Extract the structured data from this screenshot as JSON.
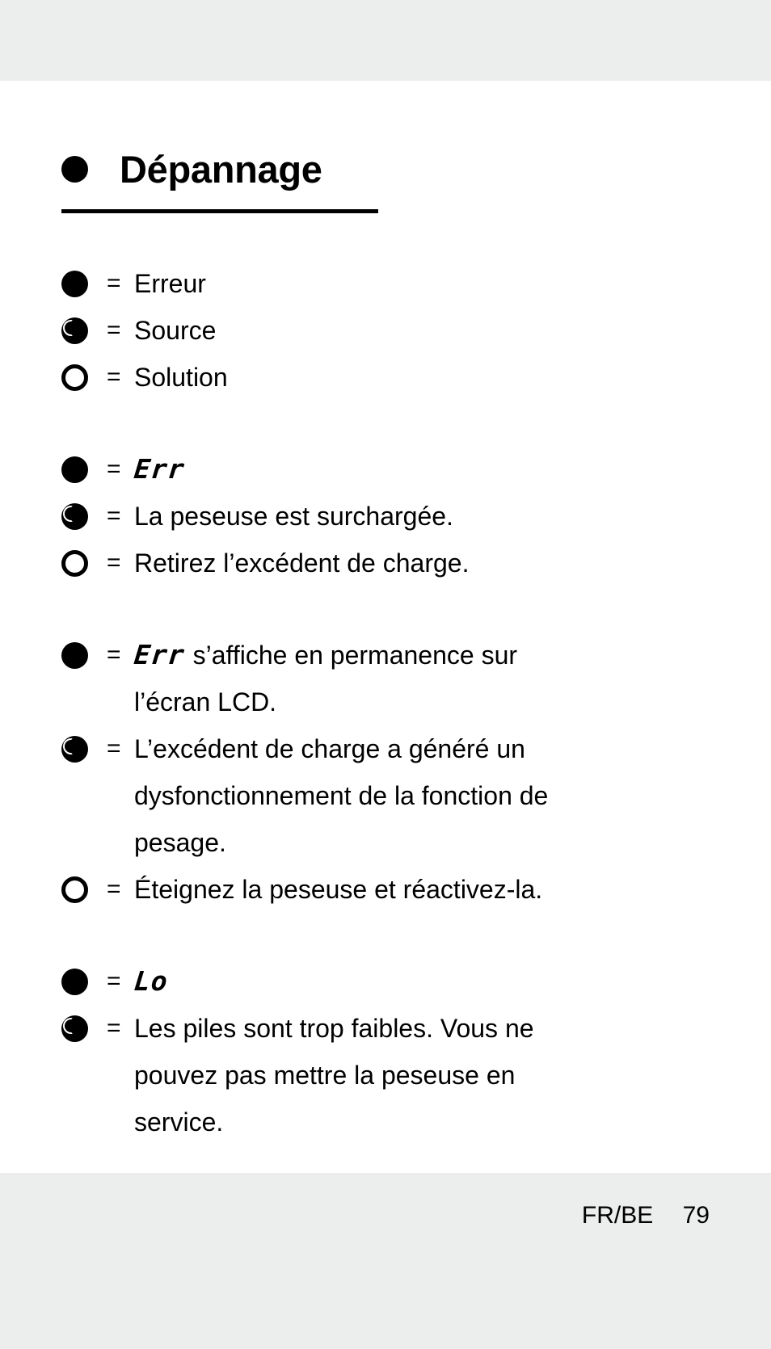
{
  "page": {
    "title": "Dépannage",
    "title_bullet_icon": "filled-circle-icon"
  },
  "legend": [
    {
      "marker": "filled-circle",
      "eq": "=",
      "label": "Erreur"
    },
    {
      "marker": "moon-circle",
      "eq": "=",
      "label": "Source"
    },
    {
      "marker": "hollow-circle",
      "eq": "=",
      "label": "Solution"
    }
  ],
  "blocks": [
    {
      "id": "err-overload",
      "rows": [
        {
          "marker": "filled-circle",
          "eq": "=",
          "lcd": "Err",
          "text": ""
        },
        {
          "marker": "moon-circle",
          "eq": "=",
          "lcd": "",
          "text": "La peseuse est surchargée."
        },
        {
          "marker": "hollow-circle",
          "eq": "=",
          "lcd": "",
          "text": "Retirez l’excédent de charge."
        }
      ]
    },
    {
      "id": "err-permanent",
      "rows": [
        {
          "marker": "filled-circle",
          "eq": "=",
          "lcd": "Err",
          "text": "s’affiche en permanence sur",
          "continuations": [
            "l’écran LCD."
          ]
        },
        {
          "marker": "moon-circle",
          "eq": "=",
          "lcd": "",
          "text": "L’excédent de charge a généré un",
          "continuations": [
            "dysfonctionnement de la fonction de",
            "pesage."
          ]
        },
        {
          "marker": "hollow-circle",
          "eq": "=",
          "lcd": "",
          "text": "Éteignez la peseuse et réactivez-la.",
          "continuations": []
        }
      ]
    },
    {
      "id": "lo-battery",
      "rows": [
        {
          "marker": "filled-circle",
          "eq": "=",
          "lcd": "Lo",
          "text": ""
        },
        {
          "marker": "moon-circle",
          "eq": "=",
          "lcd": "",
          "text": "Les piles sont trop faibles. Vous ne",
          "continuations": [
            "pouvez pas mettre la peseuse en",
            "service."
          ]
        }
      ]
    }
  ],
  "footer": {
    "locale": "FR/BE",
    "page_number": "79"
  }
}
